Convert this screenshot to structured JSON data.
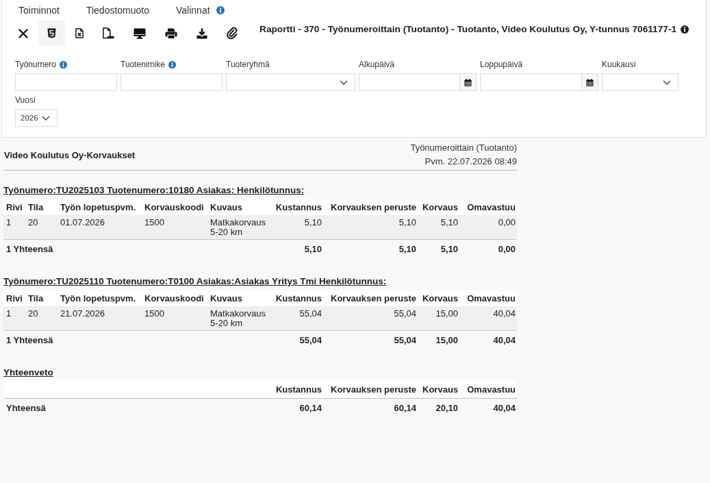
{
  "menu": [
    {
      "label": "Toiminnot",
      "info": false
    },
    {
      "label": "Tiedostomuoto",
      "info": false
    },
    {
      "label": "Valinnat",
      "info": true
    }
  ],
  "toolbar": [
    {
      "kind": "close",
      "selected": false
    },
    {
      "kind": "html",
      "selected": true
    },
    {
      "kind": "excel",
      "selected": false
    },
    {
      "kind": "pdf",
      "selected": false
    },
    {
      "kind": "screen",
      "selected": false
    },
    {
      "kind": "print",
      "selected": false
    },
    {
      "kind": "download",
      "selected": false
    },
    {
      "kind": "attach",
      "selected": false
    }
  ],
  "report_title": {
    "text": "Raportti - 370 - Työnumeroittain (Tuotanto) - Tuotanto, Video Koulutus Oy, Y-tunnus 7061177-1",
    "info": true
  },
  "filters": [
    {
      "kind": "text",
      "label": "Työnumero",
      "info": true
    },
    {
      "kind": "text",
      "label": "Tuotenimike",
      "info": true
    },
    {
      "kind": "select",
      "label": "Tuoteryhmä",
      "info": false
    },
    {
      "kind": "date",
      "label": "Alkupäivä",
      "info": false
    },
    {
      "kind": "date",
      "label": "Loppupäivä",
      "info": false
    },
    {
      "kind": "select",
      "label": "Kuukausi",
      "info": false
    },
    {
      "kind": "select",
      "label": "Vuosi",
      "info": false,
      "value": "2026"
    }
  ],
  "report": {
    "heading": "Video Koulutus Oy-Korvaukset",
    "subtitle": "Työnumeroittain (Tuotanto)",
    "date": "Pvm. 22.07.2026 08:49",
    "groups": [
      {
        "title": "Työnumero:TU2025103 Tuotenumero:10180 Asiakas: Henkilötunnus:",
        "columns": [
          "Rivi",
          "Tila",
          "Työn lopetuspvm.",
          "Korvauskoodi",
          "Kuvaus",
          "Kustannus",
          "Korvauksen peruste",
          "Korvaus",
          "Omavastuu"
        ],
        "rows": [
          [
            "1",
            "20",
            "01.07.2026",
            "1500",
            "Matkakorvaus 5-20 km",
            "5,10",
            "5,10",
            "5,10",
            "0,00"
          ]
        ],
        "total": [
          "1 Yhteensä",
          "5,10",
          "5,10",
          "5,10",
          "0,00"
        ]
      },
      {
        "title": "Työnumero:TU2025110 Tuotenumero:T0100 Asiakas:Asiakas Yritys Tmi Henkilötunnus:",
        "columns": [
          "Rivi",
          "Tila",
          "Työn lopetuspvm.",
          "Korvauskoodi",
          "Kuvaus",
          "Kustannus",
          "Korvauksen peruste",
          "Korvaus",
          "Omavastuu"
        ],
        "rows": [
          [
            "1",
            "20",
            "21.07.2026",
            "1500",
            "Matkakorvaus 5-20 km",
            "55,04",
            "55,04",
            "15,00",
            "40,04"
          ]
        ],
        "total": [
          "1 Yhteensä",
          "55,04",
          "55,04",
          "15,00",
          "40,04"
        ]
      }
    ],
    "summary": {
      "title": "Yhteenveto",
      "columns": [
        "Kustannus",
        "Korvauksen peruste",
        "Korvaus",
        "Omavastuu"
      ],
      "total": [
        "Yhteensä",
        "60,14",
        "60,14",
        "20,10",
        "40,04"
      ]
    }
  }
}
